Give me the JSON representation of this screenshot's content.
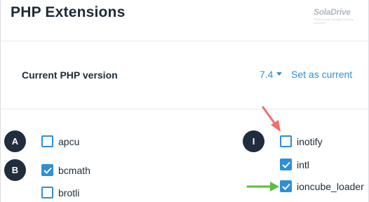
{
  "header": {
    "title": "PHP Extensions",
    "watermark": {
      "brand": "SolaDrive",
      "tagline": "Professional managed hosting solutions"
    }
  },
  "php_version": {
    "label": "Current PHP version",
    "selected": "7.4",
    "set_current_label": "Set as current"
  },
  "markers": [
    {
      "text": "A"
    },
    {
      "text": "B"
    },
    {
      "text": "I"
    }
  ],
  "extensions": [
    {
      "name": "apcu",
      "checked": false
    },
    {
      "name": "bcmath",
      "checked": true
    },
    {
      "name": "brotli",
      "checked": false
    },
    {
      "name": "inotify",
      "checked": false
    },
    {
      "name": "intl",
      "checked": true
    },
    {
      "name": "ioncube_loader",
      "checked": true
    }
  ],
  "annotations": {
    "red_arrow_color": "#f26d6d",
    "green_arrow_color": "#5ebd3e"
  },
  "colors": {
    "accent": "#2e8fd8",
    "text": "#1e2b37",
    "marker_bg": "#1f2d3d"
  }
}
